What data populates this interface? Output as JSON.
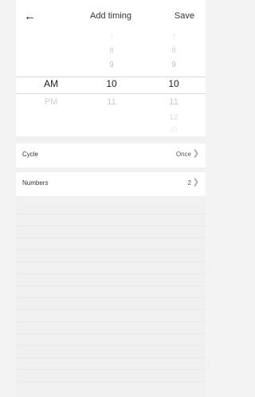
{
  "header": {
    "back_icon": "←",
    "title": "Add timing",
    "save_label": "Save"
  },
  "picker": {
    "ampm": {
      "selected": "AM",
      "below": [
        "PM"
      ]
    },
    "hours": {
      "above": [
        "7",
        "8",
        "9"
      ],
      "selected": "10",
      "below": [
        "11"
      ]
    },
    "minutes": {
      "above": [
        "7",
        "8",
        "9"
      ],
      "selected": "10",
      "below": [
        "11",
        "12",
        "13"
      ]
    }
  },
  "settings": [
    {
      "label": "Cycle",
      "value": "Once"
    },
    {
      "label": "Numbers",
      "value": "2"
    }
  ],
  "colors": {
    "background": "#f3f3f3",
    "card": "#ffffff",
    "text": "#222222"
  }
}
